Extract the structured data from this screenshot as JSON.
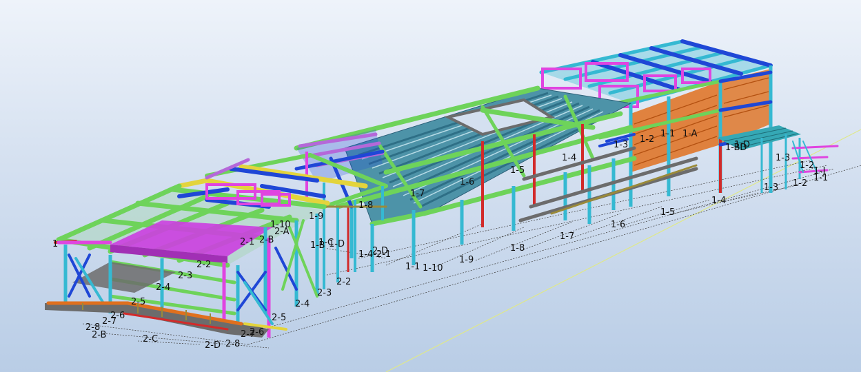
{
  "colors": {
    "green": "#6ed35a",
    "cyan": "#35b9d2",
    "teal_deck": "#4d93a8",
    "magenta": "#e044e0",
    "purple": "#b568d9",
    "blue": "#1f47d6",
    "yellow": "#e3d43c",
    "orange": "#e0701e",
    "red": "#d22a2a",
    "gray": "#6c6c6c",
    "olive": "#9a8a3a"
  },
  "grid_labels": {
    "l_1_1_top": "1-1",
    "l_1_A_top": "1-A",
    "l_1_2_top": "1-2",
    "l_1_3_top": "1-3",
    "l_1_4_deck": "1-4",
    "l_1_5_deck": "1-5",
    "l_1_6_deck": "1-6",
    "l_1_7_deck": "1-7",
    "l_1_8_deck": "1-8",
    "l_1_9_mid": "1-9",
    "l_1_10_mid": "1-10",
    "l_1_B": "1-B",
    "l_1_C": "1-C",
    "l_1_D": "1-D",
    "l_1_BD_right": "1-BD",
    "l_1_D_right": "1-D",
    "l_1_3_right": "1-3",
    "l_1_2_right": "1-2",
    "l_1_J": "1-J",
    "l_1_1_right": "1-1",
    "l_1_4_ground": "1-4",
    "l_1_5_ground": "1-5",
    "l_1_6_ground": "1-6",
    "l_1_7_ground": "1-7",
    "l_1_8_ground": "1-8",
    "l_1_9_ground": "1-9",
    "l_1_10_ground": "1-10",
    "l_1_1_ground": "1-1",
    "l_1_D_ground": "1-D",
    "l_1_4_2_1": "1-4-2-1",
    "l_2_D_mid": "2-D",
    "l_2_A": "2-A",
    "l_2_B": "2-B",
    "l_2_1": "2-1",
    "l_2_2_deck": "2-2",
    "l_2_2_right": "2-2",
    "l_2_3_deck": "2-3",
    "l_2_3_right": "2-3",
    "l_2_4_deck": "2-4",
    "l_2_4_right": "2-4",
    "l_2_5_deck": "2-5",
    "l_2_5_right": "2-5",
    "l_2_6": "2-6",
    "l_2_7": "2-7",
    "l_2_8": "2-8",
    "l_2_8_b": "2-8",
    "l_2_7_b": "2-7",
    "l_2_6_b": "2-6",
    "l_2_B_ground": "2-B",
    "l_2_C_ground": "2-C",
    "l_2_D_ground": "2-D",
    "l_1_left": "1"
  }
}
